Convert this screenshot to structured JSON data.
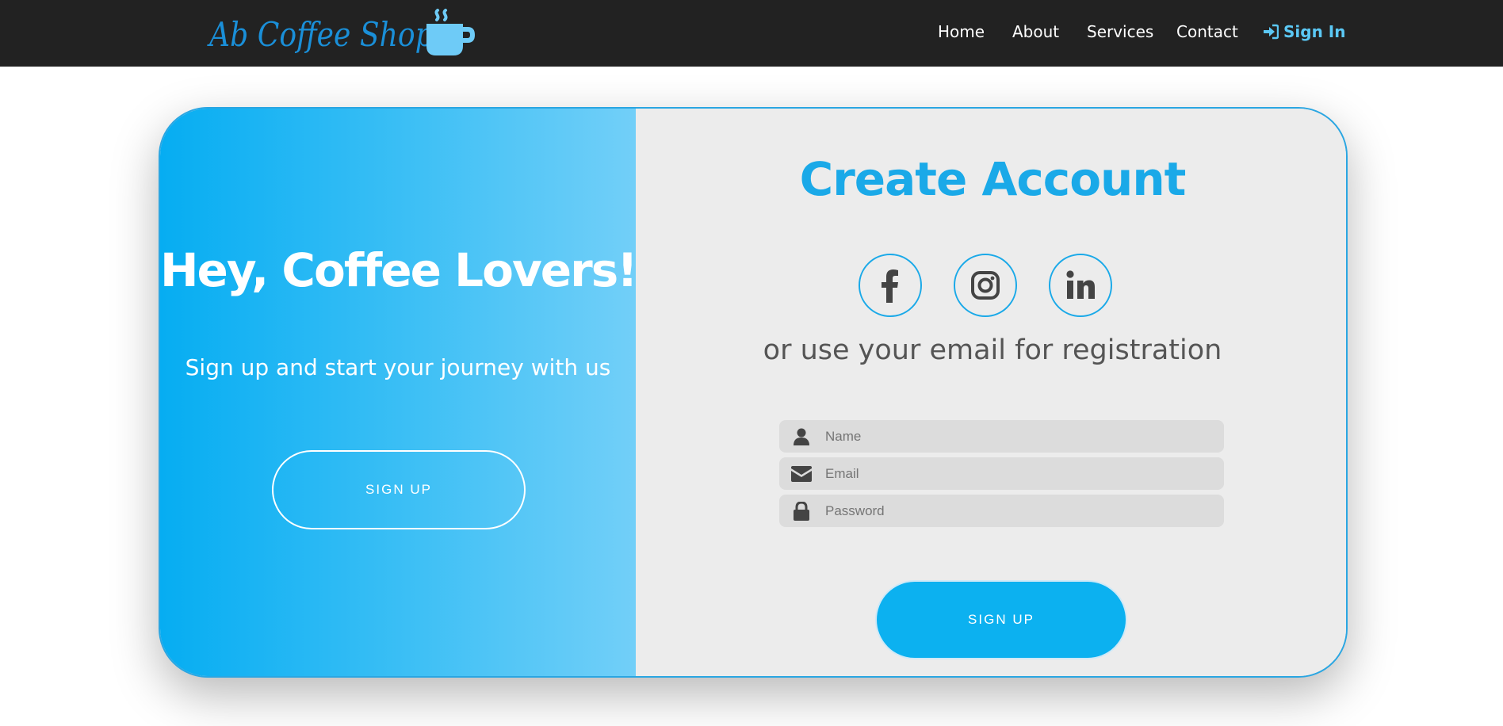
{
  "nav": {
    "brand": "Ab Coffee Shop",
    "brand_icon": "coffee-cup-icon",
    "links": [
      "Home",
      "About",
      "Services",
      "Contact"
    ],
    "signin_label": "Sign In",
    "signin_icon": "sign-in-icon"
  },
  "welcome": {
    "title": "Hey, Coffee Lovers!",
    "subtitle": "Sign up and start your journey with us",
    "button_label": "SIGN UP"
  },
  "register": {
    "title": "Create Account",
    "social": [
      "facebook-icon",
      "instagram-icon",
      "linkedin-icon"
    ],
    "subtitle": "or use your email for registration",
    "fields": {
      "name": {
        "placeholder": "Name",
        "value": "",
        "icon": "user-icon"
      },
      "email": {
        "placeholder": "Email",
        "value": "",
        "icon": "envelope-icon"
      },
      "password": {
        "placeholder": "Password",
        "value": "",
        "icon": "lock-icon"
      }
    },
    "button_label": "SIGN UP"
  },
  "colors": {
    "navbar": "#222222",
    "brand": "#1a8fd8",
    "accent": "#1aa9e8",
    "signin": "#5bc8f5",
    "panel_gradient_start": "#06adf2",
    "panel_gradient_end": "#72cff8",
    "form_bg": "#ececec",
    "field_bg": "#dcdcdc",
    "button": "#0cb1f0"
  }
}
